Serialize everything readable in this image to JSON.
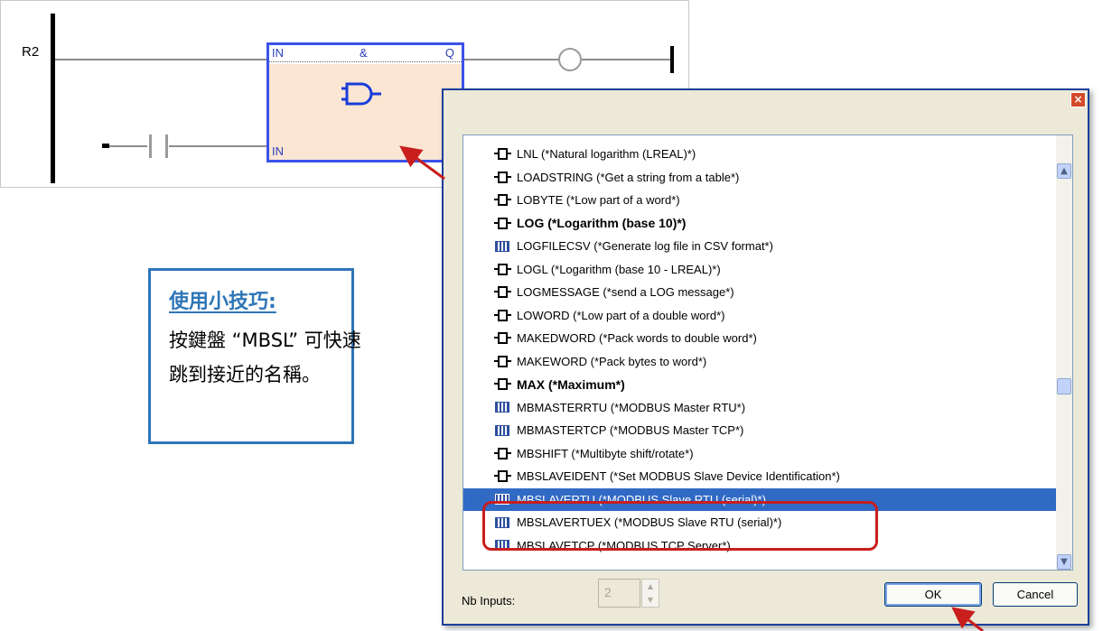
{
  "ladder": {
    "rung_label": "R2",
    "block": {
      "operator": "&",
      "input1": "IN",
      "input2": "IN",
      "output": "Q"
    }
  },
  "dialog": {
    "close_icon": "×",
    "items": [
      {
        "label": "LNL (*Natural logarithm (LREAL)*)",
        "icon": "function-icon",
        "bold": false,
        "selected": false
      },
      {
        "label": "LOADSTRING (*Get a string from a table*)",
        "icon": "function-icon",
        "bold": false,
        "selected": false
      },
      {
        "label": "LOBYTE (*Low part of a word*)",
        "icon": "function-icon",
        "bold": false,
        "selected": false
      },
      {
        "label": "LOG (*Logarithm (base 10)*)",
        "icon": "function-icon",
        "bold": true,
        "selected": false
      },
      {
        "label": "LOGFILECSV (*Generate log file in CSV format*)",
        "icon": "function-block-icon",
        "bold": false,
        "selected": false
      },
      {
        "label": "LOGL (*Logarithm (base 10 - LREAL)*)",
        "icon": "function-icon",
        "bold": false,
        "selected": false
      },
      {
        "label": "LOGMESSAGE (*send a LOG message*)",
        "icon": "function-icon",
        "bold": false,
        "selected": false
      },
      {
        "label": "LOWORD (*Low part of a double word*)",
        "icon": "function-icon",
        "bold": false,
        "selected": false
      },
      {
        "label": "MAKEDWORD (*Pack words to double word*)",
        "icon": "function-icon",
        "bold": false,
        "selected": false
      },
      {
        "label": "MAKEWORD (*Pack bytes to word*)",
        "icon": "function-icon",
        "bold": false,
        "selected": false
      },
      {
        "label": "MAX (*Maximum*)",
        "icon": "function-icon",
        "bold": true,
        "selected": false
      },
      {
        "label": "MBMASTERRTU (*MODBUS Master RTU*)",
        "icon": "function-block-icon",
        "bold": false,
        "selected": false
      },
      {
        "label": "MBMASTERTCP (*MODBUS Master TCP*)",
        "icon": "function-block-icon",
        "bold": false,
        "selected": false
      },
      {
        "label": "MBSHIFT (*Multibyte shift/rotate*)",
        "icon": "function-icon",
        "bold": false,
        "selected": false
      },
      {
        "label": "MBSLAVEIDENT (*Set MODBUS Slave Device Identification*)",
        "icon": "function-icon",
        "bold": false,
        "selected": false
      },
      {
        "label": "MBSLAVERTU (*MODBUS Slave RTU (serial)*)",
        "icon": "function-block-icon",
        "bold": false,
        "selected": true
      },
      {
        "label": "MBSLAVERTUEX (*MODBUS Slave RTU (serial)*)",
        "icon": "function-block-icon",
        "bold": false,
        "selected": false
      },
      {
        "label": "MBSLAVETCP (*MODBUS TCP Server*)",
        "icon": "function-block-icon",
        "bold": false,
        "selected": false
      }
    ],
    "nb_inputs_label": "Nb Inputs:",
    "nb_inputs_value": "2",
    "ok_label": "OK",
    "cancel_label": "Cancel",
    "selection_color": "#316ac5"
  },
  "tip": {
    "title": "使用小技巧:",
    "line1": "按鍵盤 “MBSL” 可快速",
    "line2": "跳到接近的名稱。"
  },
  "annotation_color": "#c81e1e"
}
